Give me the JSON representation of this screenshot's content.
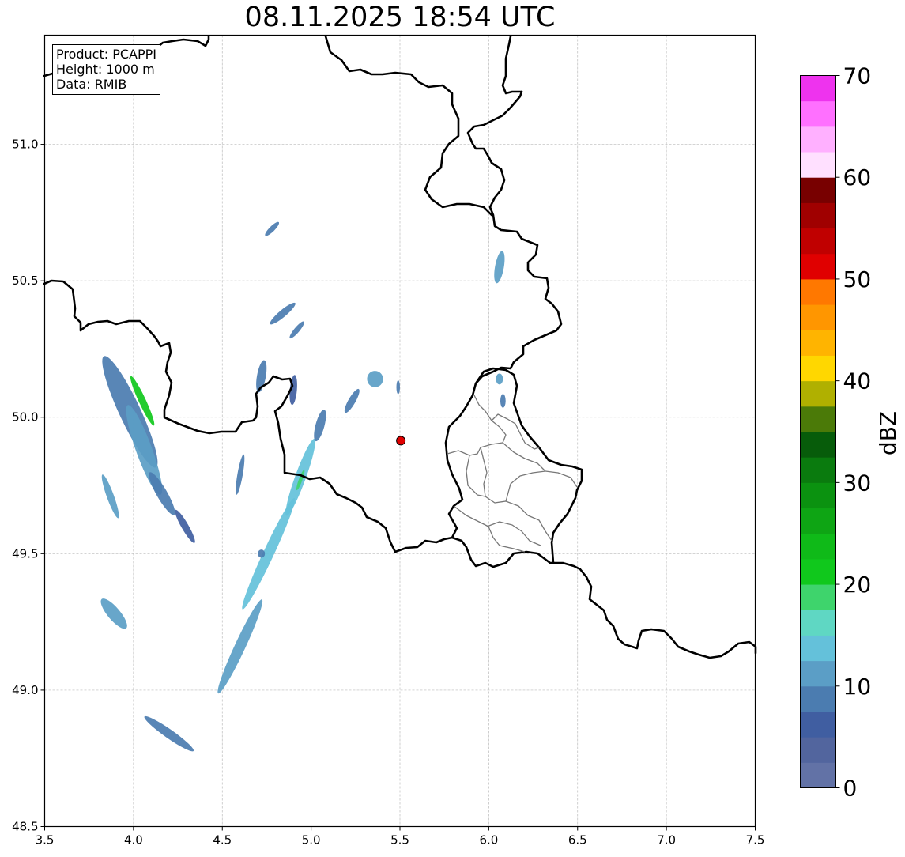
{
  "title": "08.11.2025 18:54 UTC",
  "info_box": {
    "product": "Product: PCAPPI",
    "height": "Height: 1000 m",
    "data": "Data: RMIB"
  },
  "map": {
    "lon_range": [
      3.5,
      7.5
    ],
    "lat_range": [
      48.5,
      51.4
    ],
    "x_ticks": [
      "3.5",
      "4.0",
      "4.5",
      "5.0",
      "5.5",
      "6.0",
      "6.5",
      "7.0",
      "7.5"
    ],
    "y_ticks": [
      "48.5",
      "49.0",
      "49.5",
      "50.0",
      "50.5",
      "51.0"
    ],
    "gridlines": true,
    "radar_site": {
      "lon": 5.505,
      "lat": 49.914,
      "color": "#e00000"
    }
  },
  "colorbar": {
    "label": "dBZ",
    "vmin": 0,
    "vmax": 70,
    "ticks": [
      "0",
      "10",
      "20",
      "30",
      "40",
      "50",
      "60",
      "70"
    ],
    "colors": [
      "#6272a6",
      "#52659e",
      "#405ea1",
      "#4b7cb0",
      "#5b9ec6",
      "#64c1da",
      "#5fd7c3",
      "#3ed46c",
      "#10c81c",
      "#0fba18",
      "#0ea514",
      "#0b9210",
      "#0a7b0e",
      "#075c0a",
      "#4b7a08",
      "#b0b000",
      "#ffd700",
      "#ffb400",
      "#ff9600",
      "#ff7800",
      "#e00000",
      "#c00000",
      "#a00000",
      "#780000",
      "#ffe0ff",
      "#ffb0ff",
      "#ff70ff",
      "#ee33ee"
    ]
  },
  "echoes": [
    {
      "lon": 3.98,
      "lat": 50.02,
      "w": 0.12,
      "h": 0.45,
      "rot": -25,
      "dbz": 9
    },
    {
      "lon": 4.06,
      "lat": 49.88,
      "w": 0.09,
      "h": 0.35,
      "rot": -20,
      "dbz": 12
    },
    {
      "lon": 4.05,
      "lat": 50.06,
      "w": 0.04,
      "h": 0.2,
      "rot": -25,
      "dbz": 22
    },
    {
      "lon": 4.16,
      "lat": 49.72,
      "w": 0.06,
      "h": 0.18,
      "rot": -30,
      "dbz": 8
    },
    {
      "lon": 4.29,
      "lat": 49.6,
      "w": 0.04,
      "h": 0.14,
      "rot": -30,
      "dbz": 7
    },
    {
      "lon": 3.87,
      "lat": 49.71,
      "w": 0.04,
      "h": 0.17,
      "rot": -20,
      "dbz": 10
    },
    {
      "lon": 3.89,
      "lat": 49.28,
      "w": 0.07,
      "h": 0.14,
      "rot": -40,
      "dbz": 12
    },
    {
      "lon": 4.2,
      "lat": 48.84,
      "w": 0.05,
      "h": 0.22,
      "rot": -55,
      "dbz": 9
    },
    {
      "lon": 4.6,
      "lat": 49.16,
      "w": 0.06,
      "h": 0.38,
      "rot": 25,
      "dbz": 11
    },
    {
      "lon": 4.76,
      "lat": 49.5,
      "w": 0.06,
      "h": 0.45,
      "rot": 25,
      "dbz": 13
    },
    {
      "lon": 4.94,
      "lat": 49.78,
      "w": 0.06,
      "h": 0.3,
      "rot": 20,
      "dbz": 14
    },
    {
      "lon": 4.94,
      "lat": 49.77,
      "w": 0.02,
      "h": 0.08,
      "rot": 20,
      "dbz": 19
    },
    {
      "lon": 4.6,
      "lat": 49.79,
      "w": 0.03,
      "h": 0.15,
      "rot": 10,
      "dbz": 8
    },
    {
      "lon": 4.72,
      "lat": 49.5,
      "w": 0.04,
      "h": 0.03,
      "rot": 0,
      "dbz": 9
    },
    {
      "lon": 4.78,
      "lat": 50.69,
      "w": 0.03,
      "h": 0.07,
      "rot": 45,
      "dbz": 8
    },
    {
      "lon": 4.84,
      "lat": 50.38,
      "w": 0.04,
      "h": 0.12,
      "rot": 50,
      "dbz": 9
    },
    {
      "lon": 4.92,
      "lat": 50.32,
      "w": 0.03,
      "h": 0.08,
      "rot": 40,
      "dbz": 8
    },
    {
      "lon": 4.72,
      "lat": 50.15,
      "w": 0.05,
      "h": 0.12,
      "rot": 10,
      "dbz": 9
    },
    {
      "lon": 4.9,
      "lat": 50.1,
      "w": 0.04,
      "h": 0.11,
      "rot": 5,
      "dbz": 7
    },
    {
      "lon": 5.05,
      "lat": 49.97,
      "w": 0.05,
      "h": 0.12,
      "rot": 15,
      "dbz": 8
    },
    {
      "lon": 5.36,
      "lat": 50.14,
      "w": 0.09,
      "h": 0.06,
      "rot": -10,
      "dbz": 12
    },
    {
      "lon": 5.23,
      "lat": 50.06,
      "w": 0.04,
      "h": 0.1,
      "rot": 30,
      "dbz": 9
    },
    {
      "lon": 5.49,
      "lat": 50.11,
      "w": 0.02,
      "h": 0.05,
      "rot": 0,
      "dbz": 8
    },
    {
      "lon": 6.06,
      "lat": 50.55,
      "w": 0.05,
      "h": 0.12,
      "rot": 10,
      "dbz": 11
    },
    {
      "lon": 6.06,
      "lat": 50.14,
      "w": 0.04,
      "h": 0.04,
      "rot": 0,
      "dbz": 12
    },
    {
      "lon": 6.08,
      "lat": 50.06,
      "w": 0.03,
      "h": 0.05,
      "rot": 0,
      "dbz": 9
    }
  ]
}
